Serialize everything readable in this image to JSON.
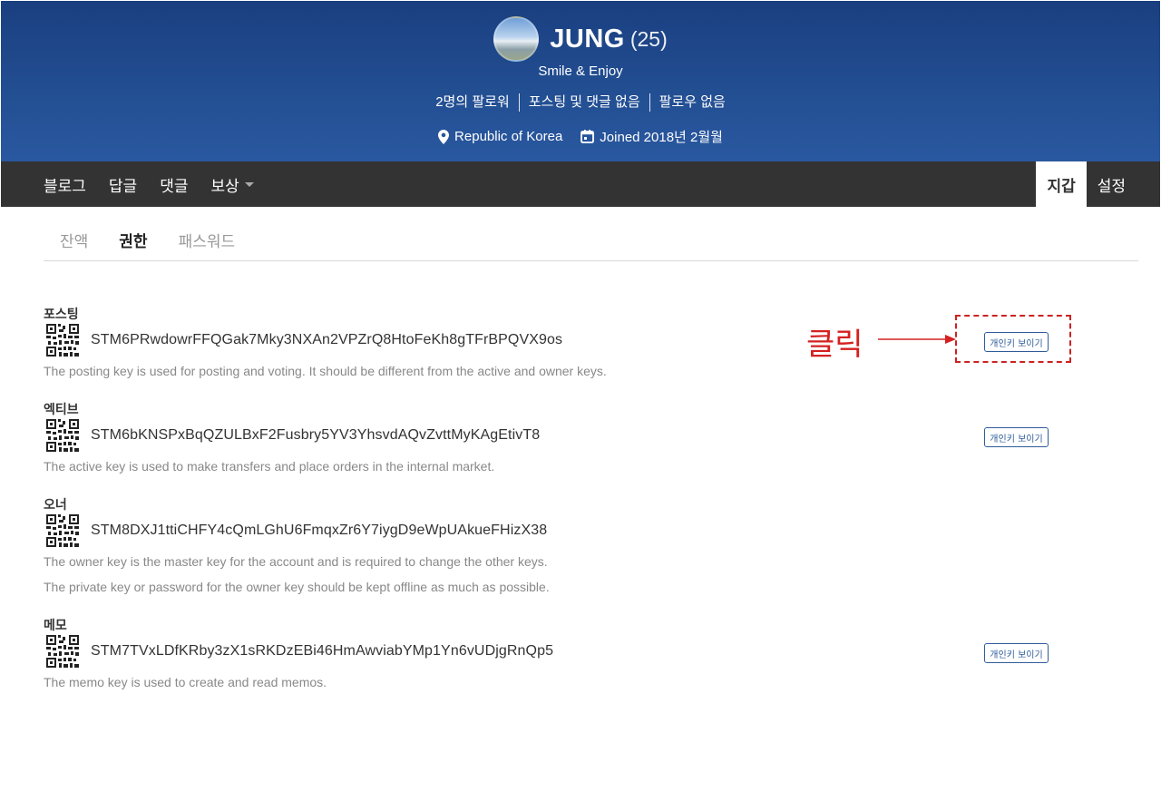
{
  "profile": {
    "name": "JUNG",
    "reputation": "(25)",
    "about": "Smile & Enjoy",
    "stats": [
      "2명의 팔로워",
      "포스팅 및 댓글 없음",
      "팔로우 없음"
    ],
    "location": "Republic of Korea",
    "joined": "Joined 2018년 2월월"
  },
  "topnav": {
    "left": [
      "블로그",
      "답글",
      "댓글",
      "보상"
    ],
    "right": [
      "지갑",
      "설정"
    ],
    "active": "지갑"
  },
  "subtabs": {
    "items": [
      "잔액",
      "권한",
      "패스워드"
    ],
    "active": "권한"
  },
  "keys": [
    {
      "label": "포스팅",
      "value": "STM6PRwdowrFFQGak7Mky3NXAn2VPZrQ8HtoFeKh8gTFrBPQVX9os",
      "desc": "The posting key is used for posting and voting. It should be different from the active and owner keys.",
      "button": "개인키 보이기"
    },
    {
      "label": "엑티브",
      "value": "STM6bKNSPxBqQZULBxF2Fusbry5YV3YhsvdAQvZvttMyKAgEtivT8",
      "desc": "The active key is used to make transfers and place orders in the internal market.",
      "button": "개인키 보이기"
    },
    {
      "label": "오너",
      "value": "STM8DXJ1ttiCHFY4cQmLGhU6FmqxZr6Y7iygD9eWpUAkueFHizX38",
      "desc": "The owner key is the master key for the account and is required to change the other keys.",
      "desc2": "The private key or password for the owner key should be kept offline as much as possible."
    },
    {
      "label": "메모",
      "value": "STM7TVxLDfKRby3zX1sRKDzEBi46HmAwviabYMp1Yn6vUDjgRnQp5",
      "desc": "The memo key is used to create and read memos.",
      "button": "개인키 보이기"
    }
  ],
  "annotation": {
    "text": "클릭",
    "color": "#d42020"
  },
  "colors": {
    "banner": "#234f93",
    "nav": "#333333",
    "button_border": "#2f5c99"
  }
}
